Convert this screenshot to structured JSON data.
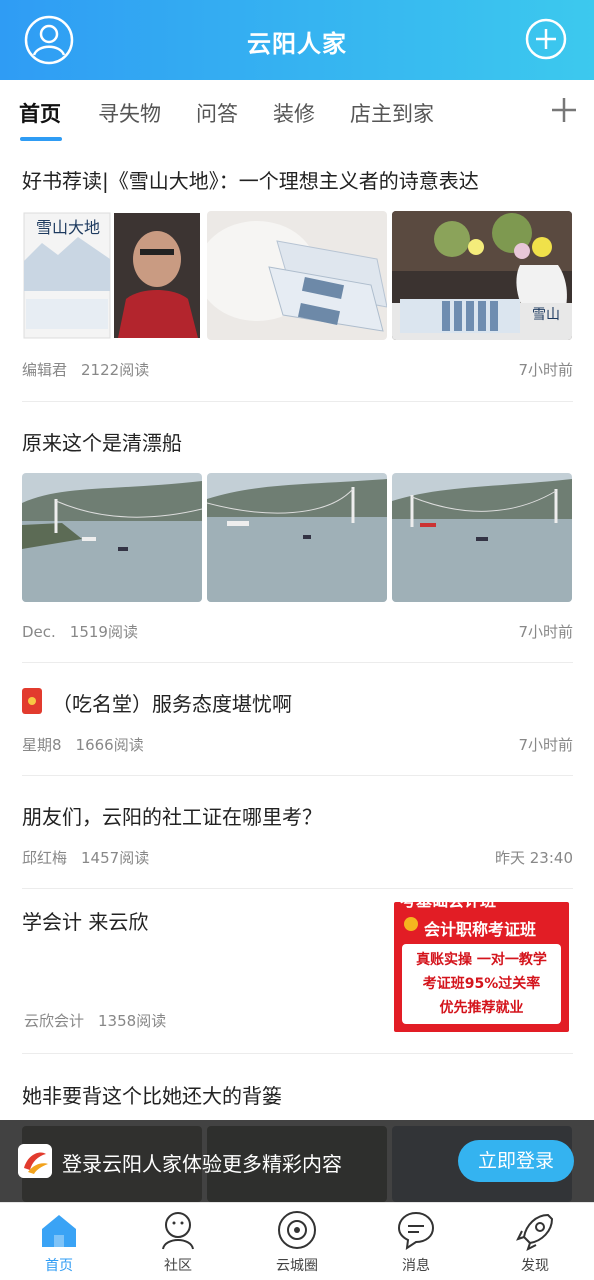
{
  "header": {
    "title": "云阳人家",
    "user_icon": "user-circle-icon",
    "add_icon": "plus-circle-icon"
  },
  "tabs": [
    {
      "label": "首页",
      "active": true
    },
    {
      "label": "寻失物"
    },
    {
      "label": "问答"
    },
    {
      "label": "装修"
    },
    {
      "label": "店主到家"
    }
  ],
  "feed": [
    {
      "title": "好书荐读|《雪山大地》：一个理想主义者的诗意表达",
      "author": "编辑君",
      "reads": "2122阅读",
      "time": "7小时前",
      "images": [
        {
          "text": "雪山大地"
        },
        {},
        {
          "text": "雪山"
        }
      ]
    },
    {
      "title": "原来这个是清漂船",
      "author": "Dec.",
      "reads": "1519阅读",
      "time": "7小时前"
    },
    {
      "title": "（吃名堂）服务态度堪忧啊",
      "author": "星期8",
      "reads": "1666阅读",
      "time": "7小时前",
      "badge_icon": "red-envelope-icon"
    },
    {
      "title": "朋友们，云阳的社工证在哪里考？",
      "author": "邱红梅",
      "reads": "1457阅读",
      "time": "昨天 23:40"
    },
    {
      "title": "学会计 来云欣",
      "author": "云欣会计",
      "reads": "1358阅读",
      "ad_lines": [
        "考基础会计班",
        "会计职称考证班",
        "真账实操 一对一教学",
        "考证班95%过关率",
        "优先推荐就业"
      ]
    },
    {
      "title": "她非要背这个比她还大的背篓"
    }
  ],
  "login_bar": {
    "text": "登录云阳人家体验更多精彩内容",
    "button": "立即登录"
  },
  "bottom_nav": [
    {
      "label": "首页",
      "icon": "home-icon",
      "active": true
    },
    {
      "label": "社区",
      "icon": "community-icon"
    },
    {
      "label": "云城圈",
      "icon": "circle-icon"
    },
    {
      "label": "消息",
      "icon": "message-icon"
    },
    {
      "label": "发现",
      "icon": "rocket-icon"
    }
  ],
  "colors": {
    "accent": "#2f9cf4",
    "header_end": "#3cc9ee"
  }
}
